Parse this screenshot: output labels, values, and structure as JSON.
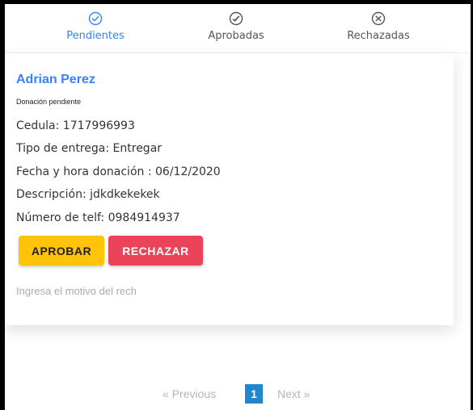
{
  "tabs": [
    {
      "label": "Pendientes",
      "icon": "check-circle-icon",
      "active": true
    },
    {
      "label": "Aprobadas",
      "icon": "check-badge-icon",
      "active": false
    },
    {
      "label": "Rechazadas",
      "icon": "close-circle-icon",
      "active": false
    }
  ],
  "donation": {
    "name": "Adrian Perez",
    "status": "Donación pendiente",
    "cedula": "Cedula: 1717996993",
    "tipo_entrega": "Tipo de entrega: Entregar",
    "fecha": "Fecha y hora donación : 06/12/2020",
    "descripcion": "Descripción: jdkdkekekek",
    "telefono": "Número de telf: 0984914937",
    "approve_label": "APROBAR",
    "reject_label": "RECHAZAR",
    "reason_placeholder": "Ingresa el motivo del rech",
    "reason_value": ""
  },
  "pagination": {
    "prev_label": "«  Previous",
    "current_page": "1",
    "next_label": "Next  »"
  },
  "colors": {
    "accent": "#3880ff",
    "approve": "#ffc409",
    "reject": "#eb445a",
    "page_active": "#2185d0"
  }
}
